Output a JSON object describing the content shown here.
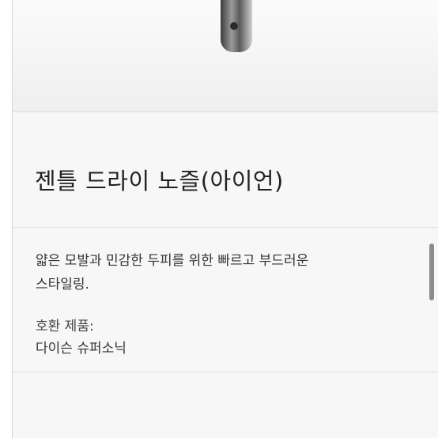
{
  "product": {
    "title": "젠틀 드라이 노즐(아이언)",
    "description_line1": "얇은 모발과 민감한 두피를 위한 빠르고 부드러운",
    "description_line2": "스타일링.",
    "compatible_label": "호환 제품:",
    "compatible_value": "다이슨 슈퍼소닉"
  }
}
